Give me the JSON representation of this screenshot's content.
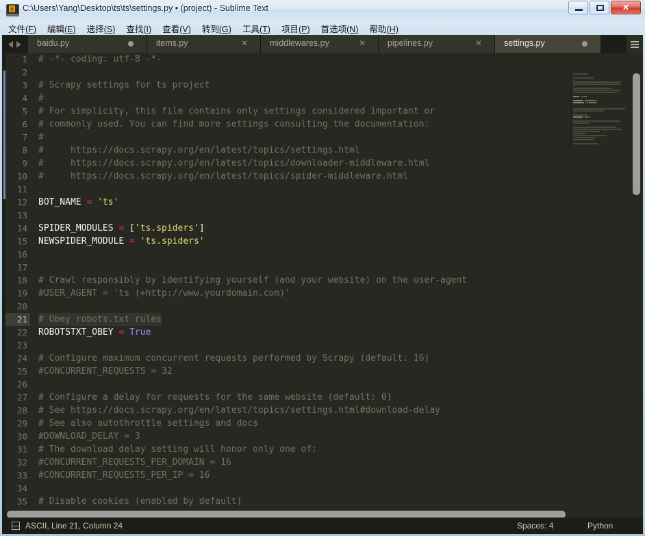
{
  "window": {
    "title": "C:\\Users\\Yang\\Desktop\\ts\\ts\\settings.py • (project) - Sublime Text",
    "icon": "sublime-text-icon",
    "buttons": {
      "minimize": "minimize-icon",
      "maximize": "maximize-icon",
      "close": "✕"
    }
  },
  "menubar": {
    "items": [
      {
        "label": "文件(F)",
        "text": "文件",
        "key": "(F)"
      },
      {
        "label": "编辑(E)",
        "text": "编辑",
        "key": "(E)"
      },
      {
        "label": "选择(S)",
        "text": "选择",
        "key": "(S)"
      },
      {
        "label": "查找(I)",
        "text": "查找",
        "key": "(I)"
      },
      {
        "label": "查看(V)",
        "text": "查看",
        "key": "(V)"
      },
      {
        "label": "转到(G)",
        "text": "转到",
        "key": "(G)"
      },
      {
        "label": "工具(T)",
        "text": "工具",
        "key": "(T)"
      },
      {
        "label": "项目(P)",
        "text": "项目",
        "key": "(P)"
      },
      {
        "label": "首选项(N)",
        "text": "首选项",
        "key": "(N)"
      },
      {
        "label": "帮助(H)",
        "text": "帮助",
        "key": "(H)"
      }
    ]
  },
  "tabbar": {
    "nav_prev": "◀",
    "nav_next": "▶",
    "menu_icon": "hamburger-menu-icon",
    "tabs": [
      {
        "label": "baidu.py",
        "active": false,
        "dirty": true,
        "close_glyph": "✕"
      },
      {
        "label": "items.py",
        "active": false,
        "dirty": false,
        "close_glyph": "✕"
      },
      {
        "label": "middlewares.py",
        "active": false,
        "dirty": false,
        "close_glyph": "✕"
      },
      {
        "label": "pipelines.py",
        "active": false,
        "dirty": false,
        "close_glyph": "✕"
      },
      {
        "label": "settings.py",
        "active": true,
        "dirty": true,
        "close_glyph": "✕"
      }
    ]
  },
  "editor": {
    "current_line": 21,
    "colors": {
      "background": "#272822",
      "comment": "#75715e",
      "string": "#e6db74",
      "operator": "#f92672",
      "constant": "#ae81ff",
      "identifier": "#f8f8f2",
      "gutter_text": "#757a69"
    },
    "lines": [
      {
        "n": 1,
        "tokens": [
          {
            "t": "# -*- coding: utf-8 -*-",
            "c": "cm"
          }
        ]
      },
      {
        "n": 2,
        "tokens": []
      },
      {
        "n": 3,
        "tokens": [
          {
            "t": "# Scrapy settings for ts project",
            "c": "cm"
          }
        ]
      },
      {
        "n": 4,
        "tokens": [
          {
            "t": "#",
            "c": "cm"
          }
        ]
      },
      {
        "n": 5,
        "tokens": [
          {
            "t": "# For simplicity, this file contains only settings considered important or",
            "c": "cm"
          }
        ]
      },
      {
        "n": 6,
        "tokens": [
          {
            "t": "# commonly used. You can find more settings consulting the documentation:",
            "c": "cm"
          }
        ]
      },
      {
        "n": 7,
        "tokens": [
          {
            "t": "#",
            "c": "cm"
          }
        ]
      },
      {
        "n": 8,
        "tokens": [
          {
            "t": "#     https://docs.scrapy.org/en/latest/topics/settings.html",
            "c": "cm"
          }
        ]
      },
      {
        "n": 9,
        "tokens": [
          {
            "t": "#     https://docs.scrapy.org/en/latest/topics/downloader-middleware.html",
            "c": "cm"
          }
        ]
      },
      {
        "n": 10,
        "tokens": [
          {
            "t": "#     https://docs.scrapy.org/en/latest/topics/spider-middleware.html",
            "c": "cm"
          }
        ]
      },
      {
        "n": 11,
        "tokens": []
      },
      {
        "n": 12,
        "tokens": [
          {
            "t": "BOT_NAME ",
            "c": "id"
          },
          {
            "t": "=",
            "c": "op"
          },
          {
            "t": " ",
            "c": "id"
          },
          {
            "t": "'ts'",
            "c": "st"
          }
        ]
      },
      {
        "n": 13,
        "tokens": []
      },
      {
        "n": 14,
        "tokens": [
          {
            "t": "SPIDER_MODULES ",
            "c": "id"
          },
          {
            "t": "=",
            "c": "op"
          },
          {
            "t": " [",
            "c": "id"
          },
          {
            "t": "'ts.spiders'",
            "c": "st"
          },
          {
            "t": "]",
            "c": "id"
          }
        ]
      },
      {
        "n": 15,
        "tokens": [
          {
            "t": "NEWSPIDER_MODULE ",
            "c": "id"
          },
          {
            "t": "=",
            "c": "op"
          },
          {
            "t": " ",
            "c": "id"
          },
          {
            "t": "'ts.spiders'",
            "c": "st"
          }
        ]
      },
      {
        "n": 16,
        "tokens": []
      },
      {
        "n": 17,
        "tokens": []
      },
      {
        "n": 18,
        "tokens": [
          {
            "t": "# Crawl responsibly by identifying yourself (and your website) on the user-agent",
            "c": "cm"
          }
        ]
      },
      {
        "n": 19,
        "tokens": [
          {
            "t": "#USER_AGENT = 'ts (+http://www.yourdomain.com)'",
            "c": "cm"
          }
        ]
      },
      {
        "n": 20,
        "tokens": []
      },
      {
        "n": 21,
        "tokens": [
          {
            "t": "# Obey robots.txt rules",
            "c": "cm"
          }
        ]
      },
      {
        "n": 22,
        "tokens": [
          {
            "t": "ROBOTSTXT_OBEY ",
            "c": "id"
          },
          {
            "t": "=",
            "c": "op"
          },
          {
            "t": " ",
            "c": "id"
          },
          {
            "t": "True",
            "c": "cn"
          }
        ]
      },
      {
        "n": 23,
        "tokens": []
      },
      {
        "n": 24,
        "tokens": [
          {
            "t": "# Configure maximum concurrent requests performed by Scrapy (default: 16)",
            "c": "cm"
          }
        ]
      },
      {
        "n": 25,
        "tokens": [
          {
            "t": "#CONCURRENT_REQUESTS = 32",
            "c": "cm"
          }
        ]
      },
      {
        "n": 26,
        "tokens": []
      },
      {
        "n": 27,
        "tokens": [
          {
            "t": "# Configure a delay for requests for the same website (default: 0)",
            "c": "cm"
          }
        ]
      },
      {
        "n": 28,
        "tokens": [
          {
            "t": "# See https://docs.scrapy.org/en/latest/topics/settings.html#download-delay",
            "c": "cm"
          }
        ]
      },
      {
        "n": 29,
        "tokens": [
          {
            "t": "# See also autothrottle settings and docs",
            "c": "cm"
          }
        ]
      },
      {
        "n": 30,
        "tokens": [
          {
            "t": "#DOWNLOAD_DELAY = 3",
            "c": "cm"
          }
        ]
      },
      {
        "n": 31,
        "tokens": [
          {
            "t": "# The download delay setting will honor only one of:",
            "c": "cm"
          }
        ]
      },
      {
        "n": 32,
        "tokens": [
          {
            "t": "#CONCURRENT_REQUESTS_PER_DOMAIN = 16",
            "c": "cm"
          }
        ]
      },
      {
        "n": 33,
        "tokens": [
          {
            "t": "#CONCURRENT_REQUESTS_PER_IP = 16",
            "c": "cm"
          }
        ]
      },
      {
        "n": 34,
        "tokens": []
      },
      {
        "n": 35,
        "tokens": [
          {
            "t": "# Disable cookies (enabled by default)",
            "c": "cm"
          }
        ]
      }
    ]
  },
  "statusbar": {
    "panel_icon": "panel-icon",
    "left": "ASCII, Line 21, Column 24",
    "spaces": "Spaces: 4",
    "syntax": "Python"
  }
}
